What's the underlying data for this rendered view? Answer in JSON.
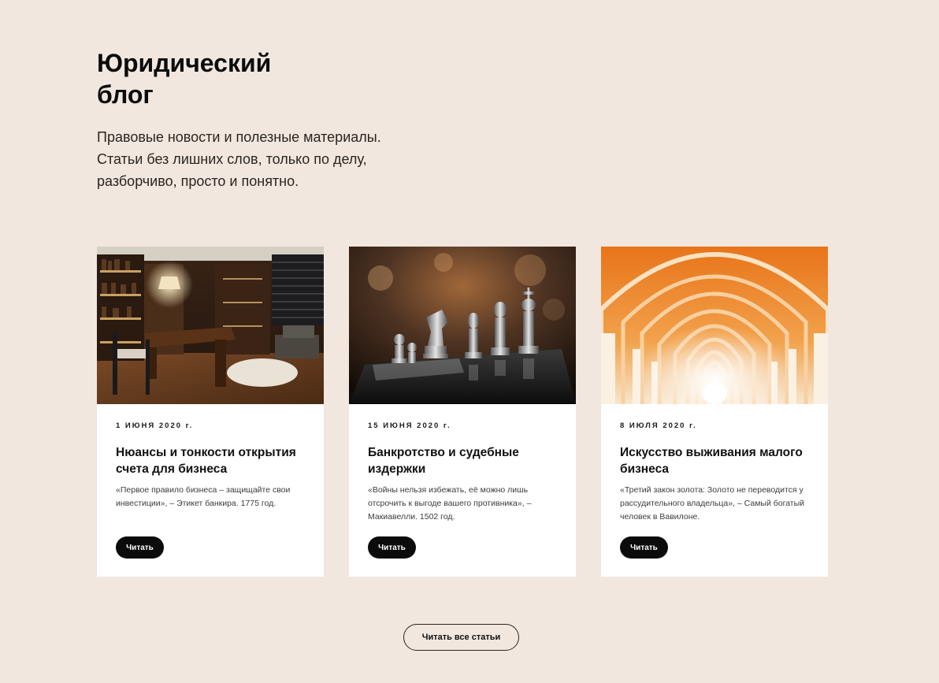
{
  "header": {
    "title": "Юридический блог",
    "intro_lines": [
      "Правовые новости и полезные материалы.",
      "Статьи без лишних слов, только по делу,",
      "разборчиво, просто и понятно."
    ]
  },
  "cards": [
    {
      "image": "law-office-photo",
      "date": "1 ИЮНЯ 2020 г.",
      "title": "Нюансы и тонкости открытия счета для бизнеса",
      "quote": "«Первое правило бизнеса – защищайте свои инвестиции», – Этикет банкира. 1775 год.",
      "button_label": "Читать"
    },
    {
      "image": "chess-pieces-photo",
      "date": "15 ИЮНЯ 2020 г.",
      "title": "Банкротство и судебные издержки",
      "quote": "«Войны нельзя избежать, её можно лишь отсрочить к выгоде вашего противника», – Макиавелли. 1502 год.",
      "button_label": "Читать"
    },
    {
      "image": "arched-corridor-photo",
      "date": "8 ИЮЛЯ 2020 г.",
      "title": "Искусство выживания малого бизнеса",
      "quote": "«Третий закон золота: Золото не переводится у рассудительного владельца», – Самый богатый человек в Вавилоне.",
      "button_label": "Читать"
    }
  ],
  "footer": {
    "all_articles_label": "Читать все статьи"
  }
}
